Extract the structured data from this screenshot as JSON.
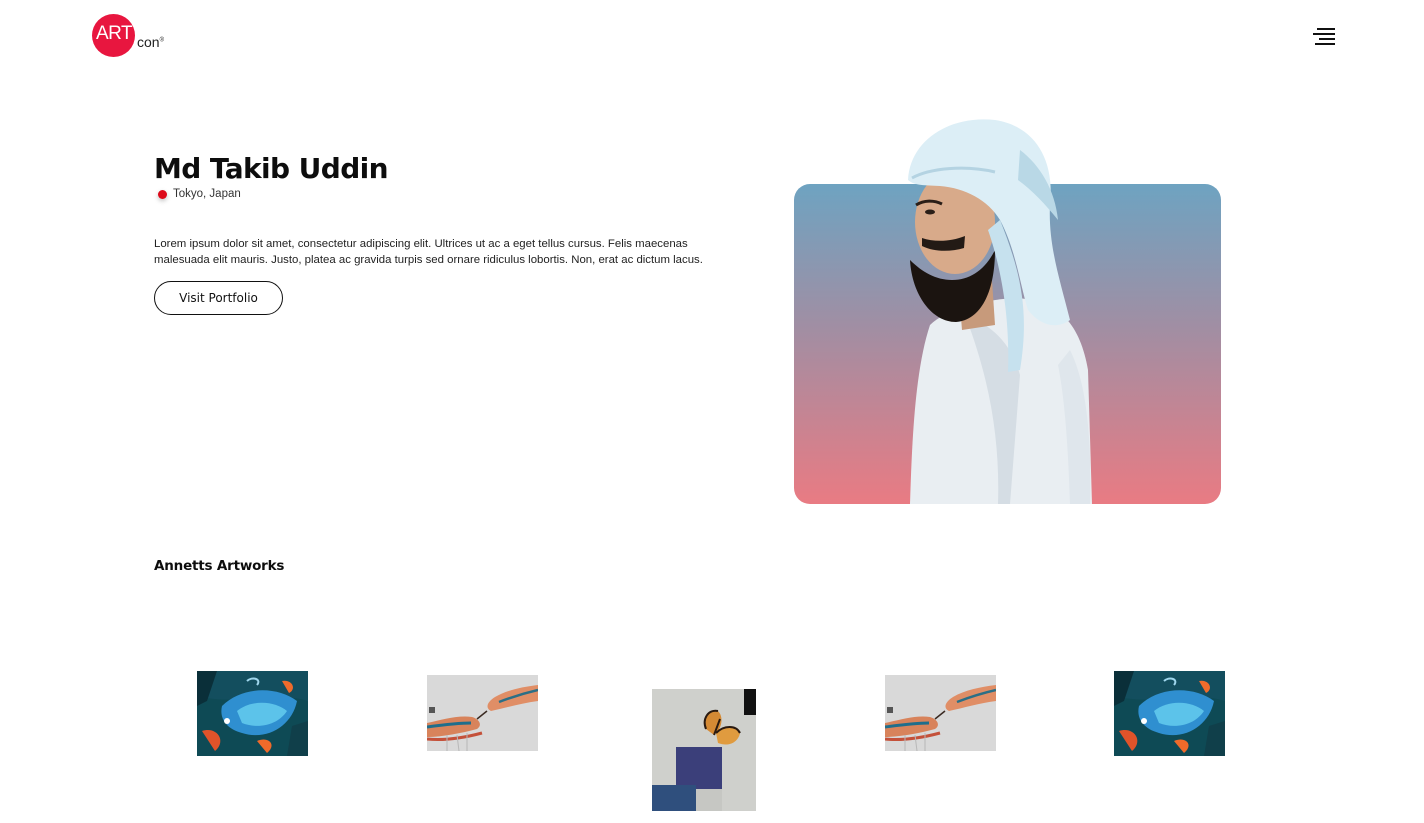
{
  "header": {
    "logo": {
      "main": "ART",
      "sub": "con",
      "mark": "®"
    },
    "menu_icon": "hamburger-menu-icon"
  },
  "hero": {
    "name": "Md Takib Uddin",
    "location": "Tokyo, Japan",
    "bio": "Lorem ipsum dolor sit amet, consectetur adipiscing elit. Ultrices ut ac a eget tellus cursus. Felis maecenas malesuada elit mauris. Justo, platea ac gravida turpis sed ornare ridiculus lobortis. Non, erat ac dictum lacus.",
    "button_label": "Visit Portfolio"
  },
  "artworks": {
    "title": "Annetts Artworks",
    "items": [
      {
        "name": "abstract-koi-painting"
      },
      {
        "name": "hands-painting"
      },
      {
        "name": "butterfly-painting"
      },
      {
        "name": "hands-painting"
      },
      {
        "name": "abstract-koi-painting"
      }
    ]
  },
  "colors": {
    "brand": "#e8163f",
    "location_dot": "#dd0a1a",
    "card_top": "#6ea3c1",
    "card_bottom": "#e97b83"
  }
}
